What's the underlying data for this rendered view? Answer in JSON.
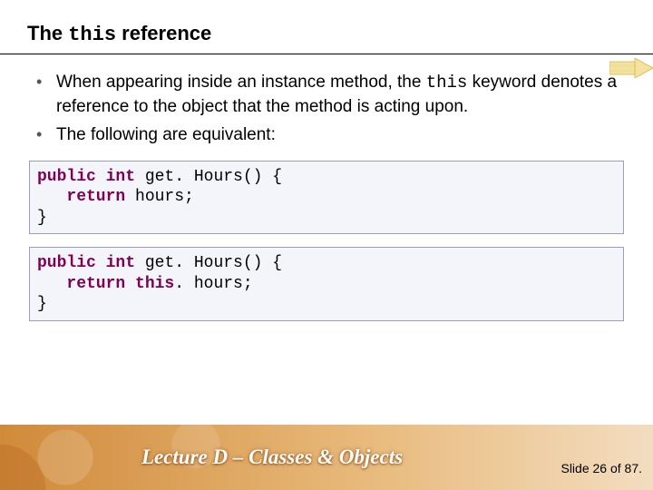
{
  "title": {
    "pre": "The ",
    "kw": "this",
    "post": " reference"
  },
  "bullets": [
    {
      "pre": "When appearing inside an instance method, the ",
      "kw": "this",
      "post": " keyword denotes a reference to the object that the method is acting upon."
    },
    {
      "pre": "The following are equivalent:",
      "kw": "",
      "post": ""
    }
  ],
  "code": [
    {
      "l1a": "public",
      "l1b": " ",
      "l1c": "int",
      "l1d": " get. Hours() {",
      "l2a": "   ",
      "l2b": "return",
      "l2c": " hours;",
      "l3": "}"
    },
    {
      "l1a": "public",
      "l1b": " ",
      "l1c": "int",
      "l1d": " get. Hours() {",
      "l2a": "   ",
      "l2b": "return",
      "l2c": " ",
      "l2d": "this",
      "l2e": ". hours;",
      "l3": "}"
    }
  ],
  "footer": {
    "lecture": "Lecture D – Classes & Objects",
    "page": "Slide 26 of 87."
  }
}
